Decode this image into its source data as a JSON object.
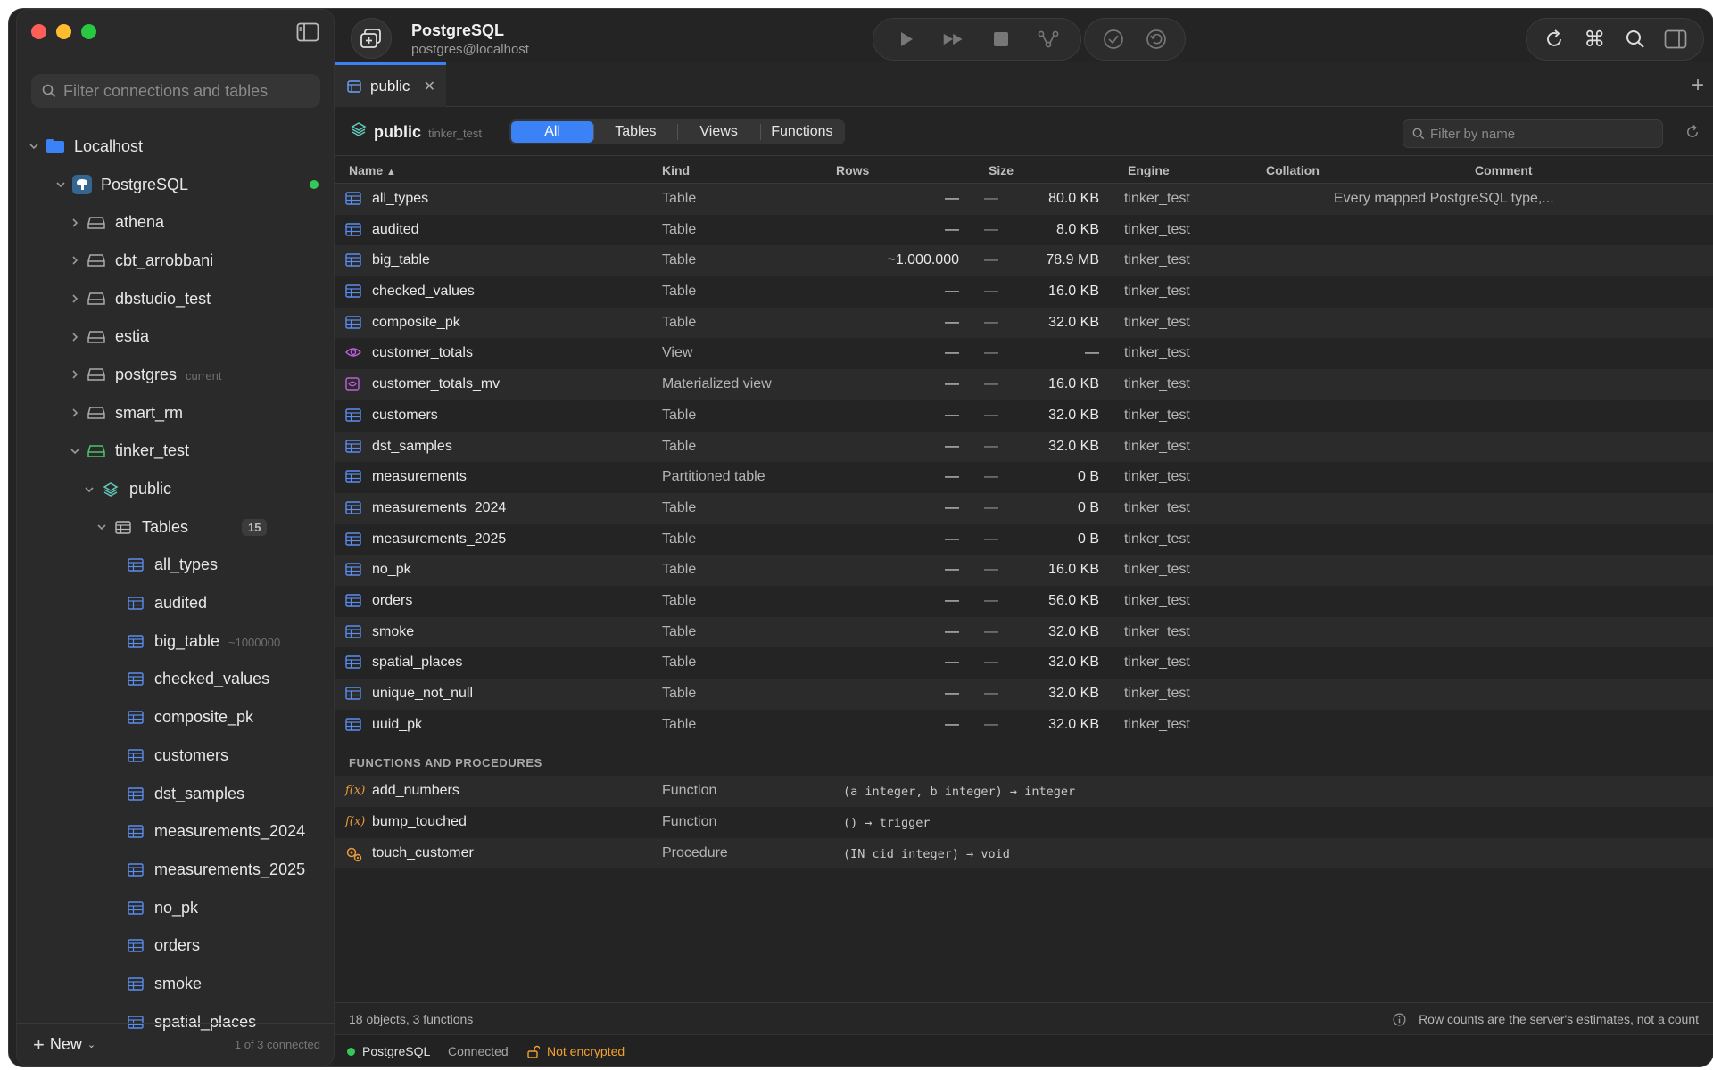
{
  "sidebar": {
    "search_placeholder": "Filter connections and tables",
    "tree": [
      {
        "label": "Localhost",
        "level": 0,
        "icon": "folder-icon",
        "chevron": "down"
      },
      {
        "label": "PostgreSQL",
        "level": 1,
        "icon": "postgres-elephant-icon",
        "chevron": "down",
        "online": true
      },
      {
        "label": "athena",
        "level": 2,
        "icon": "database-icon",
        "chevron": "right"
      },
      {
        "label": "cbt_arrobbani",
        "level": 2,
        "icon": "database-icon",
        "chevron": "right"
      },
      {
        "label": "dbstudio_test",
        "level": 2,
        "icon": "database-icon",
        "chevron": "right"
      },
      {
        "label": "estia",
        "level": 2,
        "icon": "database-icon",
        "chevron": "right"
      },
      {
        "label": "postgres",
        "level": 2,
        "icon": "database-icon",
        "chevron": "right",
        "sub": "current"
      },
      {
        "label": "smart_rm",
        "level": 2,
        "icon": "database-icon",
        "chevron": "right"
      },
      {
        "label": "tinker_test",
        "level": 2,
        "icon": "database-icon-green",
        "chevron": "down"
      },
      {
        "label": "public",
        "level": 3,
        "icon": "schema-layers-icon",
        "chevron": "down"
      },
      {
        "label": "Tables",
        "level": 4,
        "icon": "tables-grid-icon",
        "chevron": "down",
        "badge": "15"
      },
      {
        "label": "all_types",
        "level": 5,
        "icon": "table-icon"
      },
      {
        "label": "audited",
        "level": 5,
        "icon": "table-icon"
      },
      {
        "label": "big_table",
        "level": 5,
        "icon": "table-icon",
        "sub": "~1000000"
      },
      {
        "label": "checked_values",
        "level": 5,
        "icon": "table-icon"
      },
      {
        "label": "composite_pk",
        "level": 5,
        "icon": "table-icon"
      },
      {
        "label": "customers",
        "level": 5,
        "icon": "table-icon"
      },
      {
        "label": "dst_samples",
        "level": 5,
        "icon": "table-icon"
      },
      {
        "label": "measurements_2024",
        "level": 5,
        "icon": "table-icon"
      },
      {
        "label": "measurements_2025",
        "level": 5,
        "icon": "table-icon"
      },
      {
        "label": "no_pk",
        "level": 5,
        "icon": "table-icon"
      },
      {
        "label": "orders",
        "level": 5,
        "icon": "table-icon"
      },
      {
        "label": "smoke",
        "level": 5,
        "icon": "table-icon"
      },
      {
        "label": "spatial_places",
        "level": 5,
        "icon": "table-icon"
      }
    ],
    "footer": {
      "new_label": "New",
      "conn_count": "1 of 3 connected"
    }
  },
  "header": {
    "title": "PostgreSQL",
    "subtitle": "postgres@localhost"
  },
  "tabs": [
    {
      "label": "public"
    }
  ],
  "schema": {
    "name": "public",
    "database": "tinker_test",
    "segments": [
      "All",
      "Tables",
      "Views",
      "Functions"
    ],
    "active_segment": "All",
    "filter_placeholder": "Filter by name"
  },
  "columns": [
    "Name",
    "Kind",
    "Rows",
    "Size",
    "Engine",
    "Collation",
    "Comment"
  ],
  "rows": [
    {
      "name": "all_types",
      "kind": "Table",
      "rows": "—",
      "size": "80.0 KB",
      "engine": "—",
      "collation": "tinker_test",
      "comment": "Every mapped PostgreSQL type,...",
      "icon": "table-icon"
    },
    {
      "name": "audited",
      "kind": "Table",
      "rows": "—",
      "size": "8.0 KB",
      "engine": "—",
      "collation": "tinker_test",
      "comment": "",
      "icon": "table-icon"
    },
    {
      "name": "big_table",
      "kind": "Table",
      "rows": "~1.000.000",
      "size": "78.9 MB",
      "engine": "—",
      "collation": "tinker_test",
      "comment": "",
      "icon": "table-icon"
    },
    {
      "name": "checked_values",
      "kind": "Table",
      "rows": "—",
      "size": "16.0 KB",
      "engine": "—",
      "collation": "tinker_test",
      "comment": "",
      "icon": "table-icon"
    },
    {
      "name": "composite_pk",
      "kind": "Table",
      "rows": "—",
      "size": "32.0 KB",
      "engine": "—",
      "collation": "tinker_test",
      "comment": "",
      "icon": "table-icon"
    },
    {
      "name": "customer_totals",
      "kind": "View",
      "rows": "—",
      "size": "—",
      "engine": "—",
      "collation": "tinker_test",
      "comment": "",
      "icon": "view-eye-icon"
    },
    {
      "name": "customer_totals_mv",
      "kind": "Materialized view",
      "rows": "—",
      "size": "16.0 KB",
      "engine": "—",
      "collation": "tinker_test",
      "comment": "",
      "icon": "materialized-view-icon"
    },
    {
      "name": "customers",
      "kind": "Table",
      "rows": "—",
      "size": "32.0 KB",
      "engine": "—",
      "collation": "tinker_test",
      "comment": "",
      "icon": "table-icon"
    },
    {
      "name": "dst_samples",
      "kind": "Table",
      "rows": "—",
      "size": "32.0 KB",
      "engine": "—",
      "collation": "tinker_test",
      "comment": "",
      "icon": "table-icon"
    },
    {
      "name": "measurements",
      "kind": "Partitioned table",
      "rows": "—",
      "size": "0 B",
      "engine": "—",
      "collation": "tinker_test",
      "comment": "",
      "icon": "table-icon"
    },
    {
      "name": "measurements_2024",
      "kind": "Table",
      "rows": "—",
      "size": "0 B",
      "engine": "—",
      "collation": "tinker_test",
      "comment": "",
      "icon": "table-icon"
    },
    {
      "name": "measurements_2025",
      "kind": "Table",
      "rows": "—",
      "size": "0 B",
      "engine": "—",
      "collation": "tinker_test",
      "comment": "",
      "icon": "table-icon"
    },
    {
      "name": "no_pk",
      "kind": "Table",
      "rows": "—",
      "size": "16.0 KB",
      "engine": "—",
      "collation": "tinker_test",
      "comment": "",
      "icon": "table-icon"
    },
    {
      "name": "orders",
      "kind": "Table",
      "rows": "—",
      "size": "56.0 KB",
      "engine": "—",
      "collation": "tinker_test",
      "comment": "",
      "icon": "table-icon"
    },
    {
      "name": "smoke",
      "kind": "Table",
      "rows": "—",
      "size": "32.0 KB",
      "engine": "—",
      "collation": "tinker_test",
      "comment": "",
      "icon": "table-icon"
    },
    {
      "name": "spatial_places",
      "kind": "Table",
      "rows": "—",
      "size": "32.0 KB",
      "engine": "—",
      "collation": "tinker_test",
      "comment": "",
      "icon": "table-icon"
    },
    {
      "name": "unique_not_null",
      "kind": "Table",
      "rows": "—",
      "size": "32.0 KB",
      "engine": "—",
      "collation": "tinker_test",
      "comment": "",
      "icon": "table-icon"
    },
    {
      "name": "uuid_pk",
      "kind": "Table",
      "rows": "—",
      "size": "32.0 KB",
      "engine": "—",
      "collation": "tinker_test",
      "comment": "",
      "icon": "table-icon"
    }
  ],
  "functions_section": "FUNCTIONS AND PROCEDURES",
  "functions": [
    {
      "icon_text": "f(x)",
      "name": "add_numbers",
      "kind": "Function",
      "signature": "(a integer, b integer) → integer",
      "icon": "function-icon"
    },
    {
      "icon_text": "f(x)",
      "name": "bump_touched",
      "kind": "Function",
      "signature": "() → trigger",
      "icon": "function-icon"
    },
    {
      "icon_text": "",
      "name": "touch_customer",
      "kind": "Procedure",
      "signature": "(IN cid integer) → void",
      "icon": "procedure-gears-icon"
    }
  ],
  "status": {
    "summary": "18 objects, 3 functions",
    "note": "Row counts are the server's estimates, not a count"
  },
  "connection_bar": {
    "name": "PostgreSQL",
    "state": "Connected",
    "encryption": "Not encrypted"
  },
  "colors": {
    "accent": "#3b82f6",
    "online": "#34c759",
    "warning": "#f0a030",
    "view": "#c060e0"
  }
}
